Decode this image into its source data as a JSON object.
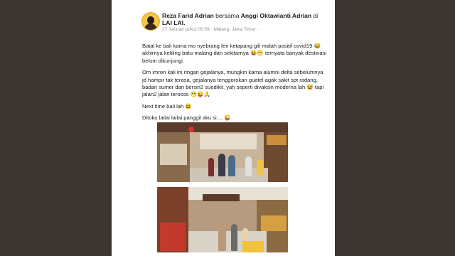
{
  "post": {
    "author": "Reza Farid Adrian",
    "with_word": "bersama",
    "tagged_user": "Anggi Oktawianti Adrian",
    "at_word": "di",
    "place": "LAI LAI.",
    "timestamp": "27 Januari pukul 05.59 · Malang, Jawa Timur ·",
    "paragraphs": [
      "Batal ke bali karna mo nyebrang feri ketapang gili malah positif covid19 😂 akhirnya keliling batu-malang dan sekitarnya 😆😁 ternyata banyak destinasi belum dikunjungi",
      "Om imron kali ini ringan gejalanya, mungkin karna alumni delta sebelumnya jd hampir tak terasa, gejalanya tenggorokan guatel agak sakit spt radang, badan sumer dan bersin2 suedikit, yah seperti divaksin moderna lah 😅 tapi jalan2 jalan terooss 😁😜🙏",
      "Next time bali lah 😆",
      "Ditoko lailai lailai panggil aku si ... 😜"
    ]
  },
  "photos": [
    {
      "name": "store-interior-photo-1"
    },
    {
      "name": "store-interior-photo-2"
    }
  ],
  "colors": {
    "background": "#3b332f",
    "card": "#ffffff",
    "text": "#1c1e21",
    "meta": "#8a8d91"
  }
}
